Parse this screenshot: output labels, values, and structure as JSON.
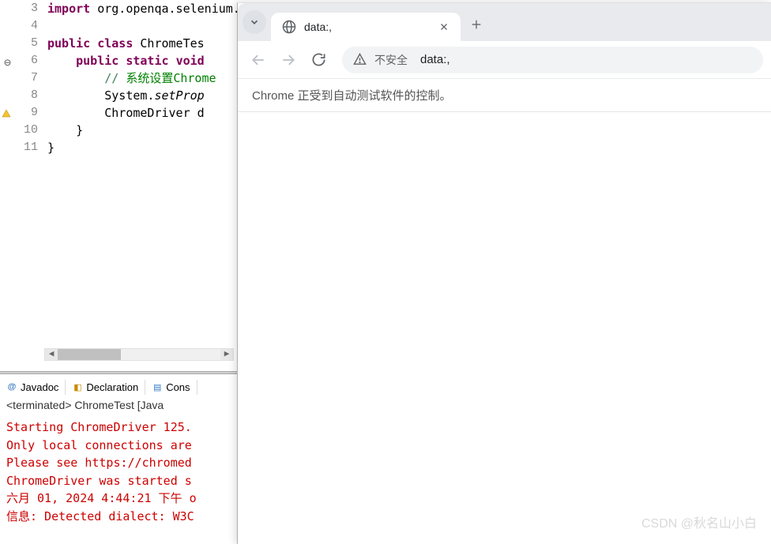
{
  "editor": {
    "lines": [
      {
        "num": "3",
        "marker": "",
        "html": "<span class='kw'>import</span><span class='txt'> org.openqa.selenium.chrome.ChromeDriver;</span>"
      },
      {
        "num": "4",
        "marker": "",
        "html": ""
      },
      {
        "num": "5",
        "marker": "",
        "html": "<span class='kw'>public class</span><span class='txt'> ChromeTes</span>"
      },
      {
        "num": "6",
        "marker": "minus",
        "html": "<span class='txt'>    </span><span class='kw'>public static</span><span class='txt'> </span><span class='kw'>void</span>"
      },
      {
        "num": "7",
        "marker": "",
        "html": "<span class='txt'>        </span><span class='cmt'>// </span><span class='cmt-zh'>系统设置Chrome</span>"
      },
      {
        "num": "8",
        "marker": "",
        "hl": true,
        "html": "<span class='txt'>        System.</span><span class='sta-ital'>setProp</span>"
      },
      {
        "num": "9",
        "marker": "warn",
        "html": "<span class='txt'>        ChromeDriver d</span>"
      },
      {
        "num": "10",
        "marker": "",
        "html": "<span class='txt'>    }</span>"
      },
      {
        "num": "11",
        "marker": "",
        "html": "<span class='txt'>}</span>"
      }
    ]
  },
  "tabs": {
    "javadoc": "Javadoc",
    "declaration": "Declaration",
    "console": "Cons"
  },
  "status": "<terminated> ChromeTest [Java ",
  "console": [
    {
      "cls": "con-red",
      "text": "Starting ChromeDriver 125."
    },
    {
      "cls": "con-red",
      "text": "Only local connections are"
    },
    {
      "cls": "con-red",
      "text": "Please see https://chromed"
    },
    {
      "cls": "con-red",
      "text": "ChromeDriver was started s"
    },
    {
      "cls": "con-red",
      "text": "六月 01, 2024 4:44:21 下午 o"
    },
    {
      "cls": "con-red",
      "text": "信息: Detected dialect: W3C"
    }
  ],
  "browser": {
    "tab_title": "data:,",
    "security_label": "不安全",
    "url": "data:,",
    "banner": "Chrome 正受到自动测试软件的控制。"
  },
  "watermark": "CSDN @秋名山小白"
}
